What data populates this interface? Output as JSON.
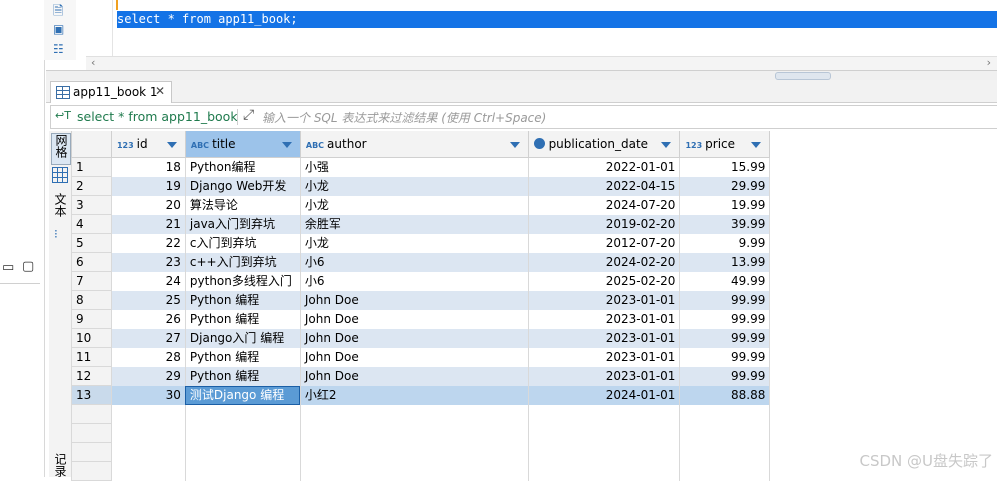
{
  "editor": {
    "sql": "select * from app11_book;"
  },
  "result_tab": {
    "label": "app11_book 1",
    "close": "✕"
  },
  "filter": {
    "query": "select * from app11_book",
    "placeholder": "输入一个 SQL 表达式来过滤结果 (使用 Ctrl+Space)"
  },
  "side_tabs": {
    "grid": "网格",
    "text": "文本",
    "log": "记录"
  },
  "columns": [
    {
      "type": "123",
      "name": "id"
    },
    {
      "type": "ABC",
      "name": "title"
    },
    {
      "type": "ABC",
      "name": "author"
    },
    {
      "type": "clock",
      "name": "publication_date"
    },
    {
      "type": "123",
      "name": "price"
    }
  ],
  "rows": [
    {
      "n": "1",
      "id": "18",
      "title": "Python编程",
      "author": "小强",
      "date": "2022-01-01",
      "price": "15.99"
    },
    {
      "n": "2",
      "id": "19",
      "title": "Django Web开发",
      "author": "小龙",
      "date": "2022-04-15",
      "price": "29.99"
    },
    {
      "n": "3",
      "id": "20",
      "title": "算法导论",
      "author": "小龙",
      "date": "2024-07-20",
      "price": "19.99"
    },
    {
      "n": "4",
      "id": "21",
      "title": "java入门到弃坑",
      "author": "余胜军",
      "date": "2019-02-20",
      "price": "39.99"
    },
    {
      "n": "5",
      "id": "22",
      "title": "c入门到弃坑",
      "author": "小龙",
      "date": "2012-07-20",
      "price": "9.99"
    },
    {
      "n": "6",
      "id": "23",
      "title": "c++入门到弃坑",
      "author": "小6",
      "date": "2024-02-20",
      "price": "13.99"
    },
    {
      "n": "7",
      "id": "24",
      "title": "python多线程入门",
      "author": "小6",
      "date": "2025-02-20",
      "price": "49.99"
    },
    {
      "n": "8",
      "id": "25",
      "title": "Python 编程",
      "author": "John Doe",
      "date": "2023-01-01",
      "price": "99.99"
    },
    {
      "n": "9",
      "id": "26",
      "title": "Python 编程",
      "author": "John Doe",
      "date": "2023-01-01",
      "price": "99.99"
    },
    {
      "n": "10",
      "id": "27",
      "title": "Django入门 编程",
      "author": "John Doe",
      "date": "2023-01-01",
      "price": "99.99"
    },
    {
      "n": "11",
      "id": "28",
      "title": "Python 编程",
      "author": "John Doe",
      "date": "2023-01-01",
      "price": "99.99"
    },
    {
      "n": "12",
      "id": "29",
      "title": "Python 编程",
      "author": "John Doe",
      "date": "2023-01-01",
      "price": "99.99"
    },
    {
      "n": "13",
      "id": "30",
      "title": "测试Django 编程",
      "author": "小红2",
      "date": "2024-01-01",
      "price": "88.88"
    }
  ],
  "selected_row": 13,
  "focused_cell": "title",
  "watermark": "CSDN @U盘失踪了",
  "colors": {
    "selection": "#1473e6",
    "alt_row": "#dce6f2",
    "header_selected": "#9cc3ea"
  }
}
